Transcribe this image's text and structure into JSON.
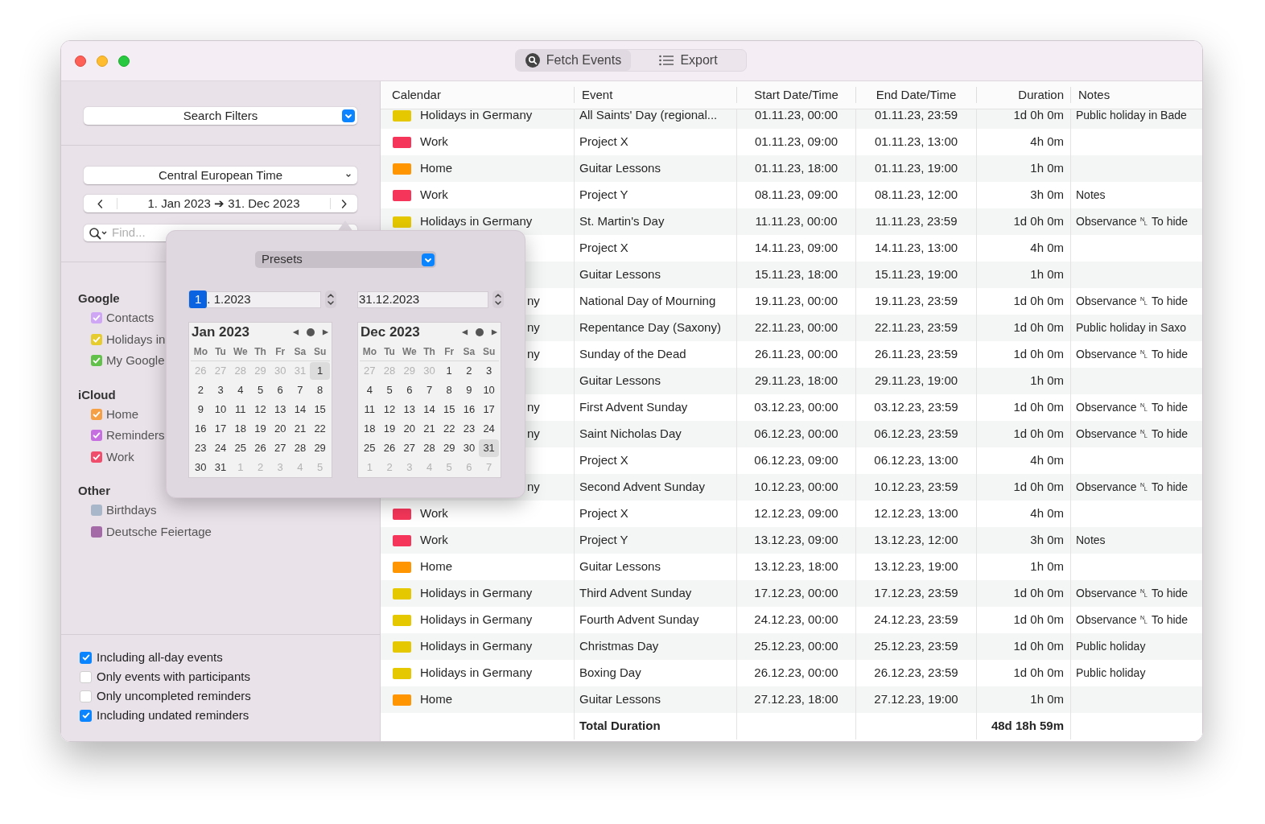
{
  "toolbar": {
    "segments": [
      {
        "label": "Fetch Events",
        "selected": true
      },
      {
        "label": "Export",
        "selected": false
      }
    ]
  },
  "sidebar": {
    "filter_popup": "Search Filters",
    "timezone": "Central European Time",
    "date_range": "1. Jan 2023 ➔ 31. Dec 2023",
    "search": {
      "placeholder": "Find..."
    },
    "groups": [
      {
        "title": "Google",
        "items": [
          {
            "label": "Contacts",
            "checked": true,
            "color": "#cfa6f6"
          },
          {
            "label": "Holidays in",
            "checked": true,
            "color": "#e6cc2e"
          },
          {
            "label": "My Google",
            "checked": true,
            "color": "#62c14a"
          }
        ]
      },
      {
        "title": "iCloud",
        "items": [
          {
            "label": "Home",
            "checked": true,
            "color": "#f5a045"
          },
          {
            "label": "Reminders",
            "checked": true,
            "color": "#c66fe0"
          },
          {
            "label": "Work",
            "checked": true,
            "color": "#f04c6c"
          }
        ]
      },
      {
        "title": "Other",
        "items": [
          {
            "label": "Birthdays",
            "checked": false,
            "color": "#a9b7ca"
          },
          {
            "label": "Deutsche Feiertage",
            "checked": false,
            "color": "#a46aa8"
          }
        ]
      }
    ],
    "options": [
      {
        "label": "Including all-day events",
        "checked": true
      },
      {
        "label": "Only events with participants",
        "checked": false
      },
      {
        "label": "Only uncompleted reminders",
        "checked": false
      },
      {
        "label": "Including undated reminders",
        "checked": true
      }
    ]
  },
  "popover": {
    "presets": "Presets",
    "start_field": {
      "segments": [
        {
          "text": "1",
          "selected": true
        },
        {
          "text": ". 1.2023",
          "selected": false
        }
      ]
    },
    "end_field": {
      "value": "31.12.2023"
    },
    "months": [
      {
        "title": "Jan 2023",
        "weekdays": [
          "Mo",
          "Tu",
          "We",
          "Th",
          "Fr",
          "Sa",
          "Su"
        ],
        "weeks": [
          [
            {
              "day": "26",
              "outside": true,
              "selected": false
            },
            {
              "day": "27",
              "outside": true,
              "selected": false
            },
            {
              "day": "28",
              "outside": true,
              "selected": false
            },
            {
              "day": "29",
              "outside": true,
              "selected": false
            },
            {
              "day": "30",
              "outside": true,
              "selected": false
            },
            {
              "day": "31",
              "outside": true,
              "selected": false
            },
            {
              "day": "1",
              "outside": false,
              "selected": true
            }
          ],
          [
            {
              "day": "2",
              "outside": false,
              "selected": false
            },
            {
              "day": "3",
              "outside": false,
              "selected": false
            },
            {
              "day": "4",
              "outside": false,
              "selected": false
            },
            {
              "day": "5",
              "outside": false,
              "selected": false
            },
            {
              "day": "6",
              "outside": false,
              "selected": false
            },
            {
              "day": "7",
              "outside": false,
              "selected": false
            },
            {
              "day": "8",
              "outside": false,
              "selected": false
            }
          ],
          [
            {
              "day": "9",
              "outside": false,
              "selected": false
            },
            {
              "day": "10",
              "outside": false,
              "selected": false
            },
            {
              "day": "11",
              "outside": false,
              "selected": false
            },
            {
              "day": "12",
              "outside": false,
              "selected": false
            },
            {
              "day": "13",
              "outside": false,
              "selected": false
            },
            {
              "day": "14",
              "outside": false,
              "selected": false
            },
            {
              "day": "15",
              "outside": false,
              "selected": false
            }
          ],
          [
            {
              "day": "16",
              "outside": false,
              "selected": false
            },
            {
              "day": "17",
              "outside": false,
              "selected": false
            },
            {
              "day": "18",
              "outside": false,
              "selected": false
            },
            {
              "day": "19",
              "outside": false,
              "selected": false
            },
            {
              "day": "20",
              "outside": false,
              "selected": false
            },
            {
              "day": "21",
              "outside": false,
              "selected": false
            },
            {
              "day": "22",
              "outside": false,
              "selected": false
            }
          ],
          [
            {
              "day": "23",
              "outside": false,
              "selected": false
            },
            {
              "day": "24",
              "outside": false,
              "selected": false
            },
            {
              "day": "25",
              "outside": false,
              "selected": false
            },
            {
              "day": "26",
              "outside": false,
              "selected": false
            },
            {
              "day": "27",
              "outside": false,
              "selected": false
            },
            {
              "day": "28",
              "outside": false,
              "selected": false
            },
            {
              "day": "29",
              "outside": false,
              "selected": false
            }
          ],
          [
            {
              "day": "30",
              "outside": false,
              "selected": false
            },
            {
              "day": "31",
              "outside": false,
              "selected": false
            },
            {
              "day": "1",
              "outside": true,
              "selected": false
            },
            {
              "day": "2",
              "outside": true,
              "selected": false
            },
            {
              "day": "3",
              "outside": true,
              "selected": false
            },
            {
              "day": "4",
              "outside": true,
              "selected": false
            },
            {
              "day": "5",
              "outside": true,
              "selected": false
            }
          ]
        ]
      },
      {
        "title": "Dec 2023",
        "weekdays": [
          "Mo",
          "Tu",
          "We",
          "Th",
          "Fr",
          "Sa",
          "Su"
        ],
        "weeks": [
          [
            {
              "day": "27",
              "outside": true,
              "selected": false
            },
            {
              "day": "28",
              "outside": true,
              "selected": false
            },
            {
              "day": "29",
              "outside": true,
              "selected": false
            },
            {
              "day": "30",
              "outside": true,
              "selected": false
            },
            {
              "day": "1",
              "outside": false,
              "selected": false
            },
            {
              "day": "2",
              "outside": false,
              "selected": false
            },
            {
              "day": "3",
              "outside": false,
              "selected": false
            }
          ],
          [
            {
              "day": "4",
              "outside": false,
              "selected": false
            },
            {
              "day": "5",
              "outside": false,
              "selected": false
            },
            {
              "day": "6",
              "outside": false,
              "selected": false
            },
            {
              "day": "7",
              "outside": false,
              "selected": false
            },
            {
              "day": "8",
              "outside": false,
              "selected": false
            },
            {
              "day": "9",
              "outside": false,
              "selected": false
            },
            {
              "day": "10",
              "outside": false,
              "selected": false
            }
          ],
          [
            {
              "day": "11",
              "outside": false,
              "selected": false
            },
            {
              "day": "12",
              "outside": false,
              "selected": false
            },
            {
              "day": "13",
              "outside": false,
              "selected": false
            },
            {
              "day": "14",
              "outside": false,
              "selected": false
            },
            {
              "day": "15",
              "outside": false,
              "selected": false
            },
            {
              "day": "16",
              "outside": false,
              "selected": false
            },
            {
              "day": "17",
              "outside": false,
              "selected": false
            }
          ],
          [
            {
              "day": "18",
              "outside": false,
              "selected": false
            },
            {
              "day": "19",
              "outside": false,
              "selected": false
            },
            {
              "day": "20",
              "outside": false,
              "selected": false
            },
            {
              "day": "21",
              "outside": false,
              "selected": false
            },
            {
              "day": "22",
              "outside": false,
              "selected": false
            },
            {
              "day": "23",
              "outside": false,
              "selected": false
            },
            {
              "day": "24",
              "outside": false,
              "selected": false
            }
          ],
          [
            {
              "day": "25",
              "outside": false,
              "selected": false
            },
            {
              "day": "26",
              "outside": false,
              "selected": false
            },
            {
              "day": "27",
              "outside": false,
              "selected": false
            },
            {
              "day": "28",
              "outside": false,
              "selected": false
            },
            {
              "day": "29",
              "outside": false,
              "selected": false
            },
            {
              "day": "30",
              "outside": false,
              "selected": false
            },
            {
              "day": "31",
              "outside": false,
              "selected": true
            }
          ],
          [
            {
              "day": "1",
              "outside": true,
              "selected": false
            },
            {
              "day": "2",
              "outside": true,
              "selected": false
            },
            {
              "day": "3",
              "outside": true,
              "selected": false
            },
            {
              "day": "4",
              "outside": true,
              "selected": false
            },
            {
              "day": "5",
              "outside": true,
              "selected": false
            },
            {
              "day": "6",
              "outside": true,
              "selected": false
            },
            {
              "day": "7",
              "outside": true,
              "selected": false
            }
          ]
        ]
      }
    ]
  },
  "table": {
    "columns": [
      "Calendar",
      "Event",
      "Start Date/Time",
      "End Date/Time",
      "Duration",
      "Notes"
    ],
    "rows": [
      {
        "kind": "full",
        "calendar": "Holidays in Germany",
        "color": "#e6c800",
        "event": "All Saints' Day (regional...",
        "start": "01.11.23, 00:00",
        "end": "01.11.23, 23:59",
        "duration": "1d 0h 0m",
        "notes": "Public holiday in Bade"
      },
      {
        "kind": "full",
        "calendar": "Work",
        "color": "#f5365a",
        "event": "Project X",
        "start": "01.11.23, 09:00",
        "end": "01.11.23, 13:00",
        "duration": "4h 0m"
      },
      {
        "kind": "full",
        "calendar": "Home",
        "color": "#ff9500",
        "event": "Guitar Lessons",
        "start": "01.11.23, 18:00",
        "end": "01.11.23, 19:00",
        "duration": "1h 0m"
      },
      {
        "kind": "full",
        "calendar": "Work",
        "color": "#f5365a",
        "event": "Project Y",
        "start": "08.11.23, 09:00",
        "end": "08.11.23, 12:00",
        "duration": "3h 0m",
        "notes": "Notes"
      },
      {
        "kind": "full",
        "calendar": "Holidays in Germany",
        "color": "#e6c800",
        "event": "St. Martin's Day",
        "start": "11.11.23, 00:00",
        "end": "11.11.23, 23:59",
        "duration": "1d 0h 0m",
        "notes": "Observance ␤ To hide"
      },
      {
        "kind": "covered",
        "event": "Project X",
        "start": "14.11.23, 09:00",
        "end": "14.11.23, 13:00",
        "duration": "4h 0m"
      },
      {
        "kind": "covered",
        "event": "Guitar Lessons",
        "start": "15.11.23, 18:00",
        "end": "15.11.23, 19:00",
        "duration": "1h 0m"
      },
      {
        "kind": "covered",
        "calendar": "ny",
        "event": "National Day of Mourning",
        "start": "19.11.23, 00:00",
        "end": "19.11.23, 23:59",
        "duration": "1d 0h 0m",
        "notes": "Observance ␤ To hide"
      },
      {
        "kind": "covered",
        "calendar": "ny",
        "event": "Repentance Day (Saxony)",
        "start": "22.11.23, 00:00",
        "end": "22.11.23, 23:59",
        "duration": "1d 0h 0m",
        "notes": "Public holiday in Saxo"
      },
      {
        "kind": "covered",
        "calendar": "ny",
        "event": "Sunday of the Dead",
        "start": "26.11.23, 00:00",
        "end": "26.11.23, 23:59",
        "duration": "1d 0h 0m",
        "notes": "Observance ␤ To hide"
      },
      {
        "kind": "covered",
        "event": "Guitar Lessons",
        "start": "29.11.23, 18:00",
        "end": "29.11.23, 19:00",
        "duration": "1h 0m"
      },
      {
        "kind": "covered",
        "calendar": "ny",
        "event": "First Advent Sunday",
        "start": "03.12.23, 00:00",
        "end": "03.12.23, 23:59",
        "duration": "1d 0h 0m",
        "notes": "Observance ␤ To hide"
      },
      {
        "kind": "covered",
        "calendar": "ny",
        "event": "Saint Nicholas Day",
        "start": "06.12.23, 00:00",
        "end": "06.12.23, 23:59",
        "duration": "1d 0h 0m",
        "notes": "Observance ␤ To hide"
      },
      {
        "kind": "covered",
        "event": "Project X",
        "start": "06.12.23, 09:00",
        "end": "06.12.23, 13:00",
        "duration": "4h 0m"
      },
      {
        "kind": "covered",
        "calendar": "ny",
        "event": "Second Advent Sunday",
        "start": "10.12.23, 00:00",
        "end": "10.12.23, 23:59",
        "duration": "1d 0h 0m",
        "notes": "Observance ␤ To hide"
      },
      {
        "kind": "full",
        "calendar": "Work",
        "color": "#f5365a",
        "event": "Project X",
        "start": "12.12.23, 09:00",
        "end": "12.12.23, 13:00",
        "duration": "4h 0m"
      },
      {
        "kind": "full",
        "calendar": "Work",
        "color": "#f5365a",
        "event": "Project Y",
        "start": "13.12.23, 09:00",
        "end": "13.12.23, 12:00",
        "duration": "3h 0m",
        "notes": "Notes"
      },
      {
        "kind": "full",
        "calendar": "Home",
        "color": "#ff9500",
        "event": "Guitar Lessons",
        "start": "13.12.23, 18:00",
        "end": "13.12.23, 19:00",
        "duration": "1h 0m"
      },
      {
        "kind": "full",
        "calendar": "Holidays in Germany",
        "color": "#e6c800",
        "event": "Third Advent Sunday",
        "start": "17.12.23, 00:00",
        "end": "17.12.23, 23:59",
        "duration": "1d 0h 0m",
        "notes": "Observance ␤ To hide"
      },
      {
        "kind": "full",
        "calendar": "Holidays in Germany",
        "color": "#e6c800",
        "event": "Fourth Advent Sunday",
        "start": "24.12.23, 00:00",
        "end": "24.12.23, 23:59",
        "duration": "1d 0h 0m",
        "notes": "Observance ␤ To hide"
      },
      {
        "kind": "full",
        "calendar": "Holidays in Germany",
        "color": "#e6c800",
        "event": "Christmas Day",
        "start": "25.12.23, 00:00",
        "end": "25.12.23, 23:59",
        "duration": "1d 0h 0m",
        "notes": "Public holiday"
      },
      {
        "kind": "full",
        "calendar": "Holidays in Germany",
        "color": "#e6c800",
        "event": "Boxing Day",
        "start": "26.12.23, 00:00",
        "end": "26.12.23, 23:59",
        "duration": "1d 0h 0m",
        "notes": "Public holiday"
      },
      {
        "kind": "full",
        "calendar": "Home",
        "color": "#ff9500",
        "event": "Guitar Lessons",
        "start": "27.12.23, 18:00",
        "end": "27.12.23, 19:00",
        "duration": "1h 0m"
      }
    ],
    "total": {
      "label": "Total Duration",
      "duration": "48d 18h 59m"
    }
  }
}
